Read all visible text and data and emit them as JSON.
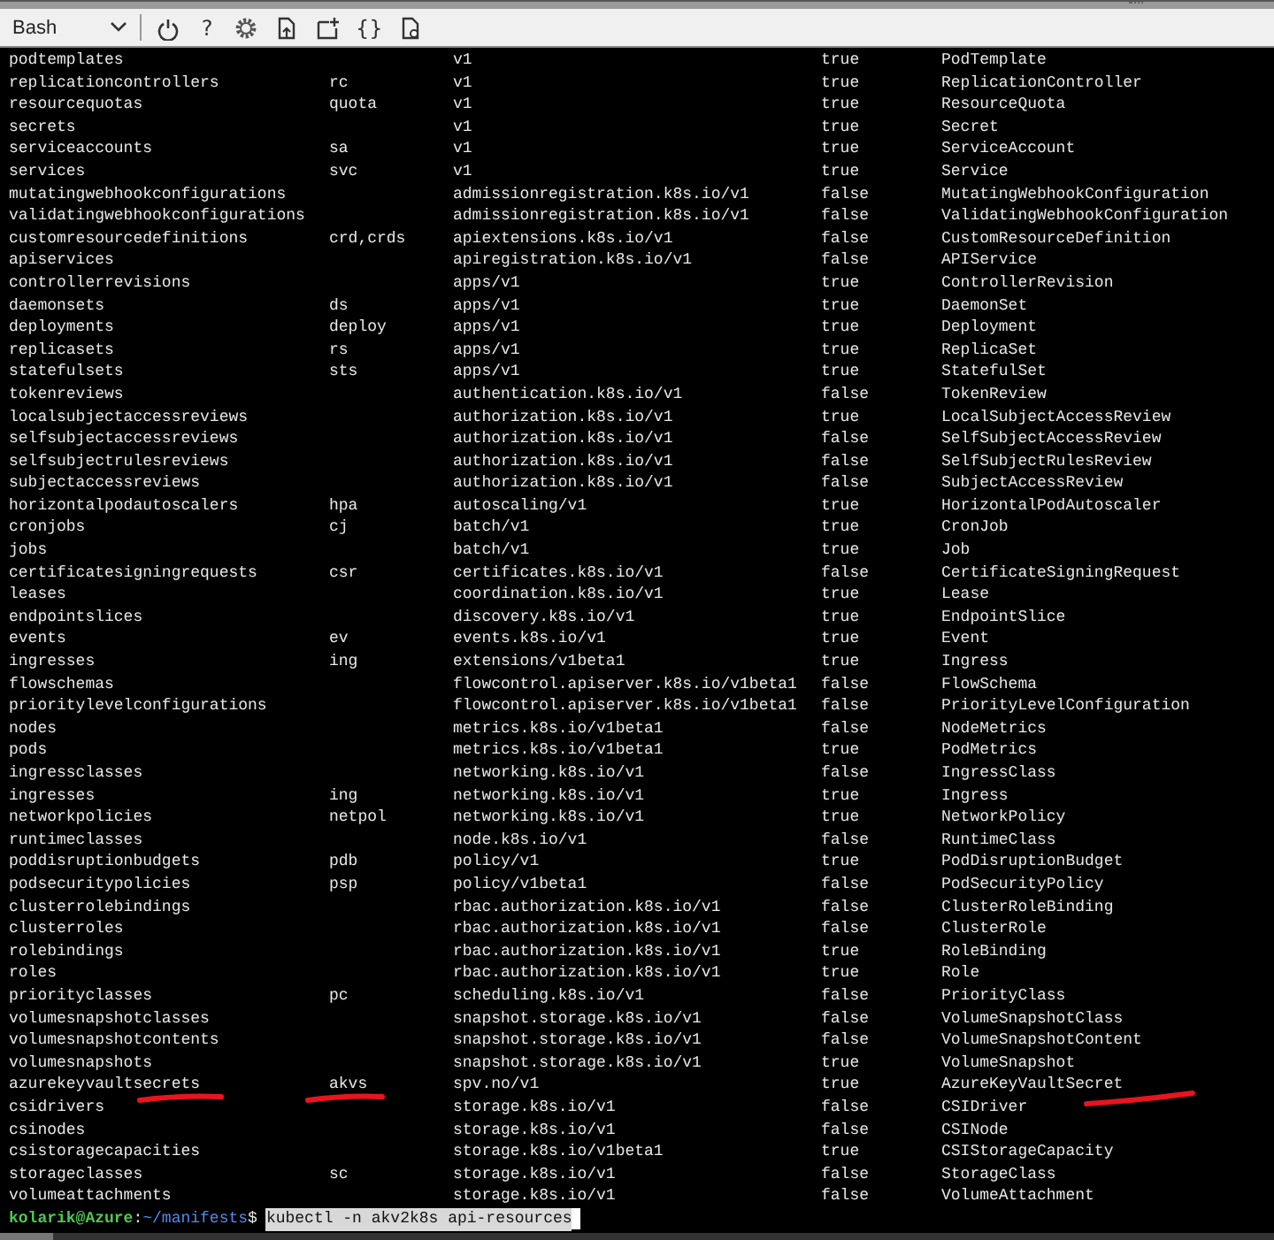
{
  "toolbar": {
    "shell": {
      "label": "Bash"
    },
    "buttons": [
      {
        "kind": "power"
      },
      {
        "kind": "glyph",
        "glyph": "?"
      },
      {
        "kind": "settings"
      },
      {
        "kind": "upload"
      },
      {
        "kind": "newfile"
      },
      {
        "kind": "glyph",
        "glyph": "{}"
      },
      {
        "kind": "preview"
      }
    ]
  },
  "rows": [
    {
      "name": "podtemplates",
      "apiversion": "v1",
      "namespaced": "true",
      "kind": "PodTemplate"
    },
    {
      "name": "replicationcontrollers",
      "shortnames": "rc",
      "apiversion": "v1",
      "namespaced": "true",
      "kind": "ReplicationController"
    },
    {
      "name": "resourcequotas",
      "shortnames": "quota",
      "apiversion": "v1",
      "namespaced": "true",
      "kind": "ResourceQuota"
    },
    {
      "name": "secrets",
      "apiversion": "v1",
      "namespaced": "true",
      "kind": "Secret"
    },
    {
      "name": "serviceaccounts",
      "shortnames": "sa",
      "apiversion": "v1",
      "namespaced": "true",
      "kind": "ServiceAccount"
    },
    {
      "name": "services",
      "shortnames": "svc",
      "apiversion": "v1",
      "namespaced": "true",
      "kind": "Service"
    },
    {
      "name": "mutatingwebhookconfigurations",
      "apiversion": "admissionregistration.k8s.io/v1",
      "namespaced": "false",
      "kind": "MutatingWebhookConfiguration"
    },
    {
      "name": "validatingwebhookconfigurations",
      "apiversion": "admissionregistration.k8s.io/v1",
      "namespaced": "false",
      "kind": "ValidatingWebhookConfiguration"
    },
    {
      "name": "customresourcedefinitions",
      "shortnames": "crd,crds",
      "apiversion": "apiextensions.k8s.io/v1",
      "namespaced": "false",
      "kind": "CustomResourceDefinition"
    },
    {
      "name": "apiservices",
      "apiversion": "apiregistration.k8s.io/v1",
      "namespaced": "false",
      "kind": "APIService"
    },
    {
      "name": "controllerrevisions",
      "apiversion": "apps/v1",
      "namespaced": "true",
      "kind": "ControllerRevision"
    },
    {
      "name": "daemonsets",
      "shortnames": "ds",
      "apiversion": "apps/v1",
      "namespaced": "true",
      "kind": "DaemonSet"
    },
    {
      "name": "deployments",
      "shortnames": "deploy",
      "apiversion": "apps/v1",
      "namespaced": "true",
      "kind": "Deployment"
    },
    {
      "name": "replicasets",
      "shortnames": "rs",
      "apiversion": "apps/v1",
      "namespaced": "true",
      "kind": "ReplicaSet"
    },
    {
      "name": "statefulsets",
      "shortnames": "sts",
      "apiversion": "apps/v1",
      "namespaced": "true",
      "kind": "StatefulSet"
    },
    {
      "name": "tokenreviews",
      "apiversion": "authentication.k8s.io/v1",
      "namespaced": "false",
      "kind": "TokenReview"
    },
    {
      "name": "localsubjectaccessreviews",
      "apiversion": "authorization.k8s.io/v1",
      "namespaced": "true",
      "kind": "LocalSubjectAccessReview"
    },
    {
      "name": "selfsubjectaccessreviews",
      "apiversion": "authorization.k8s.io/v1",
      "namespaced": "false",
      "kind": "SelfSubjectAccessReview"
    },
    {
      "name": "selfsubjectrulesreviews",
      "apiversion": "authorization.k8s.io/v1",
      "namespaced": "false",
      "kind": "SelfSubjectRulesReview"
    },
    {
      "name": "subjectaccessreviews",
      "apiversion": "authorization.k8s.io/v1",
      "namespaced": "false",
      "kind": "SubjectAccessReview"
    },
    {
      "name": "horizontalpodautoscalers",
      "shortnames": "hpa",
      "apiversion": "autoscaling/v1",
      "namespaced": "true",
      "kind": "HorizontalPodAutoscaler"
    },
    {
      "name": "cronjobs",
      "shortnames": "cj",
      "apiversion": "batch/v1",
      "namespaced": "true",
      "kind": "CronJob"
    },
    {
      "name": "jobs",
      "apiversion": "batch/v1",
      "namespaced": "true",
      "kind": "Job"
    },
    {
      "name": "certificatesigningrequests",
      "shortnames": "csr",
      "apiversion": "certificates.k8s.io/v1",
      "namespaced": "false",
      "kind": "CertificateSigningRequest"
    },
    {
      "name": "leases",
      "apiversion": "coordination.k8s.io/v1",
      "namespaced": "true",
      "kind": "Lease"
    },
    {
      "name": "endpointslices",
      "apiversion": "discovery.k8s.io/v1",
      "namespaced": "true",
      "kind": "EndpointSlice"
    },
    {
      "name": "events",
      "shortnames": "ev",
      "apiversion": "events.k8s.io/v1",
      "namespaced": "true",
      "kind": "Event"
    },
    {
      "name": "ingresses",
      "shortnames": "ing",
      "apiversion": "extensions/v1beta1",
      "namespaced": "true",
      "kind": "Ingress"
    },
    {
      "name": "flowschemas",
      "apiversion": "flowcontrol.apiserver.k8s.io/v1beta1",
      "namespaced": "false",
      "kind": "FlowSchema"
    },
    {
      "name": "prioritylevelconfigurations",
      "apiversion": "flowcontrol.apiserver.k8s.io/v1beta1",
      "namespaced": "false",
      "kind": "PriorityLevelConfiguration"
    },
    {
      "name": "nodes",
      "apiversion": "metrics.k8s.io/v1beta1",
      "namespaced": "false",
      "kind": "NodeMetrics"
    },
    {
      "name": "pods",
      "apiversion": "metrics.k8s.io/v1beta1",
      "namespaced": "true",
      "kind": "PodMetrics"
    },
    {
      "name": "ingressclasses",
      "apiversion": "networking.k8s.io/v1",
      "namespaced": "false",
      "kind": "IngressClass"
    },
    {
      "name": "ingresses",
      "shortnames": "ing",
      "apiversion": "networking.k8s.io/v1",
      "namespaced": "true",
      "kind": "Ingress"
    },
    {
      "name": "networkpolicies",
      "shortnames": "netpol",
      "apiversion": "networking.k8s.io/v1",
      "namespaced": "true",
      "kind": "NetworkPolicy"
    },
    {
      "name": "runtimeclasses",
      "apiversion": "node.k8s.io/v1",
      "namespaced": "false",
      "kind": "RuntimeClass"
    },
    {
      "name": "poddisruptionbudgets",
      "shortnames": "pdb",
      "apiversion": "policy/v1",
      "namespaced": "true",
      "kind": "PodDisruptionBudget"
    },
    {
      "name": "podsecuritypolicies",
      "shortnames": "psp",
      "apiversion": "policy/v1beta1",
      "namespaced": "false",
      "kind": "PodSecurityPolicy"
    },
    {
      "name": "clusterrolebindings",
      "apiversion": "rbac.authorization.k8s.io/v1",
      "namespaced": "false",
      "kind": "ClusterRoleBinding"
    },
    {
      "name": "clusterroles",
      "apiversion": "rbac.authorization.k8s.io/v1",
      "namespaced": "false",
      "kind": "ClusterRole"
    },
    {
      "name": "rolebindings",
      "apiversion": "rbac.authorization.k8s.io/v1",
      "namespaced": "true",
      "kind": "RoleBinding"
    },
    {
      "name": "roles",
      "apiversion": "rbac.authorization.k8s.io/v1",
      "namespaced": "true",
      "kind": "Role"
    },
    {
      "name": "priorityclasses",
      "shortnames": "pc",
      "apiversion": "scheduling.k8s.io/v1",
      "namespaced": "false",
      "kind": "PriorityClass"
    },
    {
      "name": "volumesnapshotclasses",
      "apiversion": "snapshot.storage.k8s.io/v1",
      "namespaced": "false",
      "kind": "VolumeSnapshotClass"
    },
    {
      "name": "volumesnapshotcontents",
      "apiversion": "snapshot.storage.k8s.io/v1",
      "namespaced": "false",
      "kind": "VolumeSnapshotContent"
    },
    {
      "name": "volumesnapshots",
      "apiversion": "snapshot.storage.k8s.io/v1",
      "namespaced": "true",
      "kind": "VolumeSnapshot"
    },
    {
      "name": "azurekeyvaultsecrets",
      "shortnames": "akvs",
      "apiversion": "spv.no/v1",
      "namespaced": "true",
      "kind": "AzureKeyVaultSecret",
      "marked": true
    },
    {
      "name": "csidrivers",
      "apiversion": "storage.k8s.io/v1",
      "namespaced": "false",
      "kind": "CSIDriver"
    },
    {
      "name": "csinodes",
      "apiversion": "storage.k8s.io/v1",
      "namespaced": "false",
      "kind": "CSINode"
    },
    {
      "name": "csistoragecapacities",
      "apiversion": "storage.k8s.io/v1beta1",
      "namespaced": "true",
      "kind": "CSIStorageCapacity"
    },
    {
      "name": "storageclasses",
      "shortnames": "sc",
      "apiversion": "storage.k8s.io/v1",
      "namespaced": "false",
      "kind": "StorageClass"
    },
    {
      "name": "volumeattachments",
      "apiversion": "storage.k8s.io/v1",
      "namespaced": "false",
      "kind": "VolumeAttachment"
    }
  ],
  "prompt": {
    "user": "kolarik@Azure",
    "separator": ":",
    "path": "~/manifests",
    "symbol": "$",
    "command": "kubectl -n akv2k8s api-resources",
    "command_selected": true
  }
}
